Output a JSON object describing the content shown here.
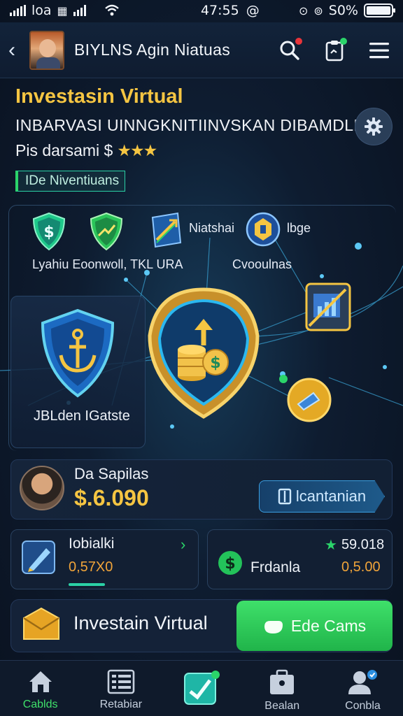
{
  "status_bar": {
    "carrier": "loa",
    "time": "47:55",
    "battery_text": "S0%"
  },
  "header": {
    "title": "BIYLNS Agin Niatuas",
    "search_dot_color": "#e8343a",
    "notif_dot_color": "#2bd46a"
  },
  "intro": {
    "title": "Investasin Virtual",
    "subtitle": "INBARVASI UINNGKNITIINVSKAN DIBAMDLL",
    "rating_text": "Pis darsami $",
    "rating_stars": "★★★",
    "tag": "IDe Niventiuans"
  },
  "network": {
    "features": [
      {
        "icon": "dollar-shield-icon"
      },
      {
        "icon": "growth-shield-icon"
      },
      {
        "icon": "arrow-chart-icon",
        "label": "Niatshai"
      },
      {
        "icon": "gold-badge-icon",
        "label": "lbge"
      }
    ],
    "feature_caption_left": "Lyahiu Eoonwoll, TKL URA",
    "feature_caption_right": "Cvooulnas",
    "left_card_label": "JBLden IGatste"
  },
  "balance": {
    "label": "Da Sapilas",
    "value": "$.6.090",
    "button_label": "lcantanian"
  },
  "stats": {
    "left": {
      "label": "Iobialki",
      "value": "0,57X0"
    },
    "right": {
      "top_value": "59.018",
      "label": "Frdanla",
      "value": "0,5.00"
    }
  },
  "action": {
    "title": "Investain Virtual",
    "button_label": "Ede Cams"
  },
  "bottom_nav": [
    {
      "label": "Cablds",
      "icon": "home-icon",
      "active": true
    },
    {
      "label": "Retabiar",
      "icon": "list-icon"
    },
    {
      "label": "",
      "icon": "check-chart-icon"
    },
    {
      "label": "Bealan",
      "icon": "briefcase-icon"
    },
    {
      "label": "Conbla",
      "icon": "profile-icon"
    }
  ],
  "colors": {
    "accent_gold": "#f5c542",
    "accent_green": "#2bd46a",
    "accent_blue": "#3a9ee0",
    "background": "#0d1626"
  }
}
